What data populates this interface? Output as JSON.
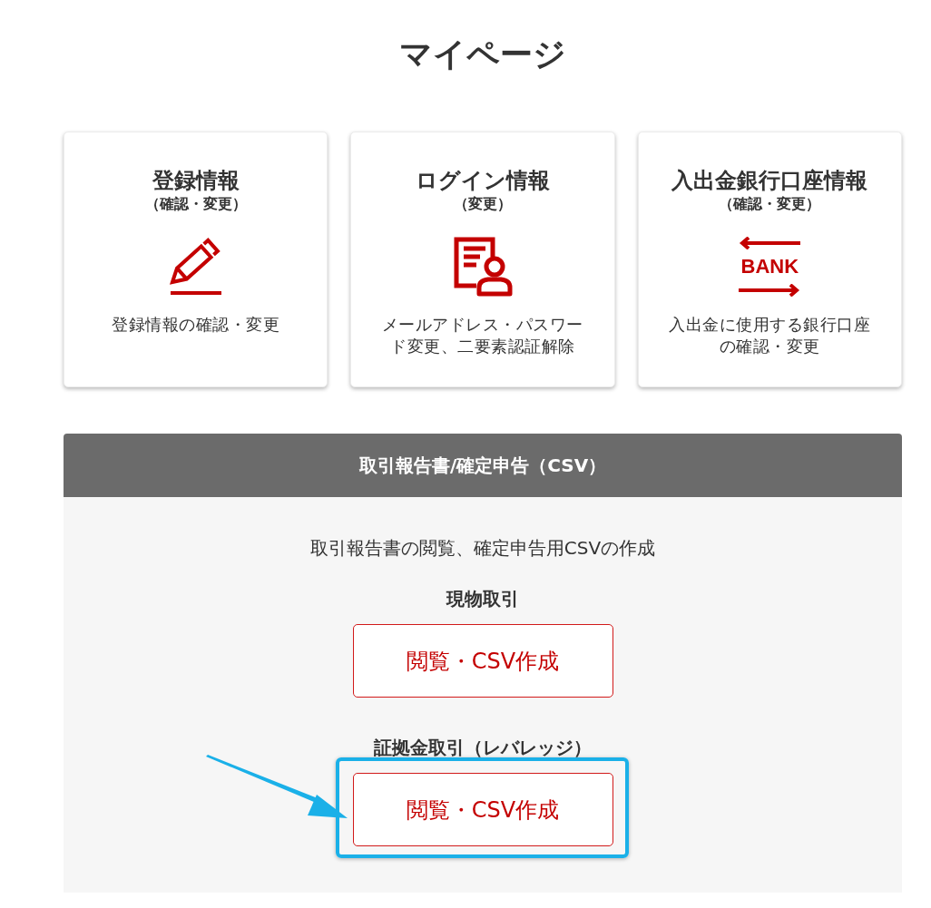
{
  "page_title": "マイページ",
  "cards": [
    {
      "title": "登録情報",
      "subtitle": "（確認・変更）",
      "icon": {
        "kind": "pencil"
      },
      "description": "登録情報の確認・変更"
    },
    {
      "title": "ログイン情報",
      "subtitle": "（変更）",
      "icon": {
        "kind": "profile"
      },
      "description": "メールアドレス・パスワード変更、二要素認証解除"
    },
    {
      "title": "入出金銀行口座情報",
      "subtitle": "（確認・変更）",
      "icon": {
        "kind": "bank",
        "label": "BANK"
      },
      "description": "入出金に使用する銀行口座の確認・変更"
    }
  ],
  "report_section": {
    "title": "取引報告書/確定申告（CSV）",
    "description": "取引報告書の閲覧、確定申告用CSVの作成",
    "groups": [
      {
        "label": "現物取引",
        "button": "閲覧・CSV作成",
        "highlighted": false
      },
      {
        "label": "証拠金取引（レバレッジ）",
        "button": "閲覧・CSV作成",
        "highlighted": true
      }
    ]
  }
}
